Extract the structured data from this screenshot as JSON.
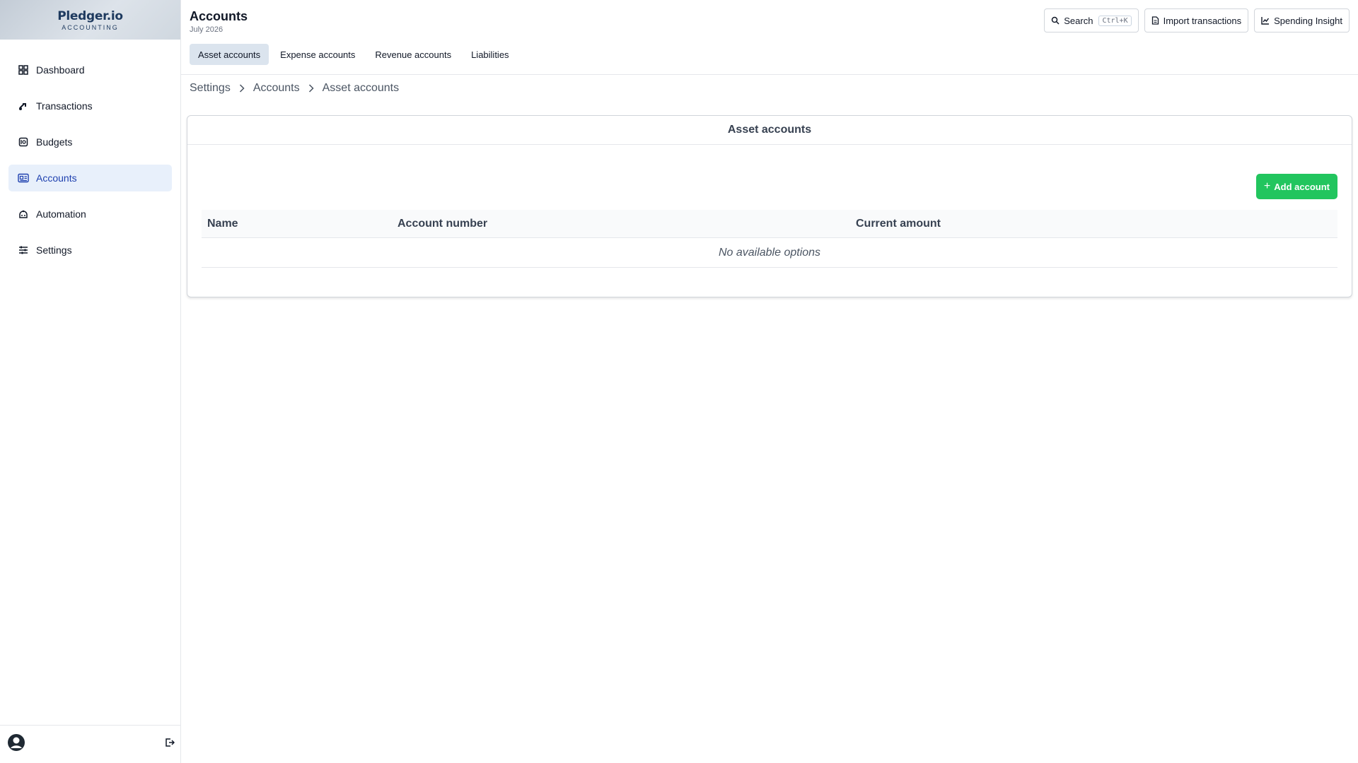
{
  "brand": {
    "name": "Pledger.io",
    "sub": "ACCOUNTING"
  },
  "sidebar": {
    "items": [
      {
        "label": "Dashboard",
        "icon": "dashboard-icon"
      },
      {
        "label": "Transactions",
        "icon": "transactions-icon"
      },
      {
        "label": "Budgets",
        "icon": "budgets-icon"
      },
      {
        "label": "Accounts",
        "icon": "accounts-icon",
        "active": true
      },
      {
        "label": "Automation",
        "icon": "automation-icon"
      },
      {
        "label": "Settings",
        "icon": "settings-icon"
      }
    ]
  },
  "header": {
    "title": "Accounts",
    "subtitle": "July 2026",
    "tabs": [
      {
        "label": "Asset accounts",
        "active": true
      },
      {
        "label": "Expense accounts"
      },
      {
        "label": "Revenue accounts"
      },
      {
        "label": "Liabilities"
      }
    ],
    "actions": {
      "search_label": "Search",
      "search_shortcut": "Ctrl+K",
      "import_label": "Import transactions",
      "insight_label": "Spending Insight"
    }
  },
  "breadcrumb": [
    "Settings",
    "Accounts",
    "Asset accounts"
  ],
  "card": {
    "title": "Asset accounts",
    "add_label": "Add account",
    "columns": [
      "Name",
      "Account number",
      "Current amount"
    ],
    "empty_text": "No available options"
  },
  "colors": {
    "accent": "#22c55e",
    "active_nav_bg": "#e8f0fb",
    "active_tab_bg": "#dbe4ee",
    "brand": "#1e3a5f"
  }
}
